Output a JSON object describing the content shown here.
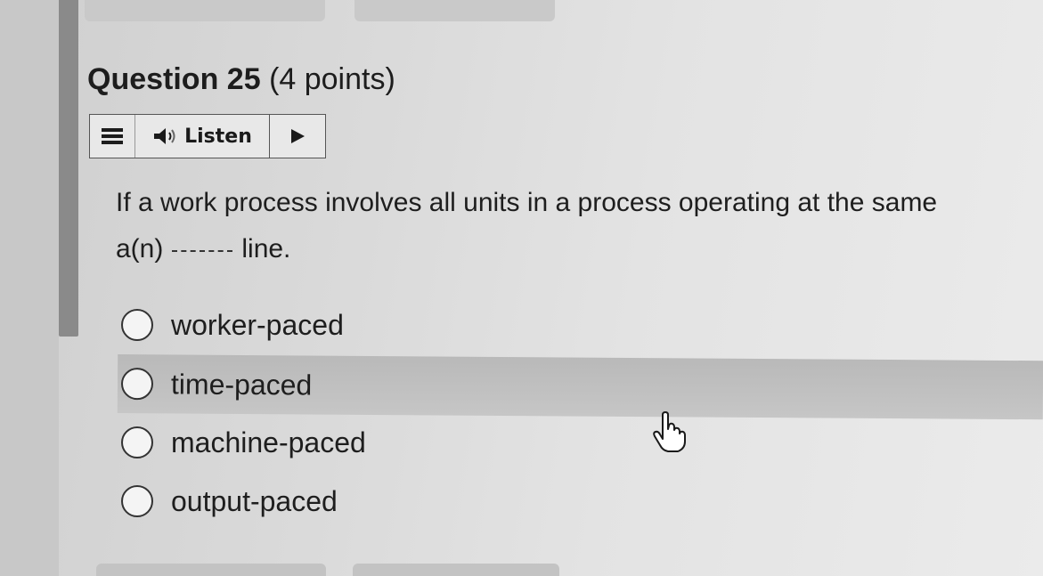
{
  "question": {
    "number_label": "Question 25",
    "points_label": "(4 points)"
  },
  "listen_toolbar": {
    "menu_icon": "hamburger-icon",
    "speaker_icon": "speaker-icon",
    "listen_label": "Listen",
    "play_icon": "play-icon"
  },
  "prompt": {
    "line1": "If a work process involves all units in a process operating at the same",
    "line2_prefix": "a(n)",
    "line2_suffix": "line."
  },
  "options": [
    {
      "label": "worker-paced",
      "selected": false
    },
    {
      "label": "time-paced",
      "selected": false
    },
    {
      "label": "machine-paced",
      "selected": false
    },
    {
      "label": "output-paced",
      "selected": false
    }
  ],
  "colors": {
    "text": "#1e1e1e",
    "hover_highlight": "#bdbdbd",
    "page_background": "#dadada"
  }
}
